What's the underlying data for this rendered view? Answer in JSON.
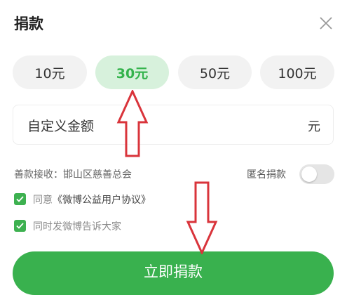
{
  "header": {
    "title": "捐款",
    "close_icon": "close-icon"
  },
  "amount_options": [
    {
      "label": "10元",
      "selected": false
    },
    {
      "label": "30元",
      "selected": true
    },
    {
      "label": "50元",
      "selected": false
    },
    {
      "label": "100元",
      "selected": false
    }
  ],
  "custom_amount": {
    "label": "自定义金额",
    "unit": "元"
  },
  "receiver": "善款接收：邯山区慈善总会",
  "anonymous": {
    "label": "匿名捐款",
    "enabled": false
  },
  "agreement": {
    "prefix": "同意",
    "link": "《微博公益用户协议》",
    "checked": true
  },
  "share": {
    "label": "同时发微博告诉大家",
    "checked": true
  },
  "submit": {
    "label": "立即捐款"
  },
  "colors": {
    "accent": "#3db150",
    "selected_bg": "#d7f1dc",
    "annotation": "#d9343b"
  }
}
